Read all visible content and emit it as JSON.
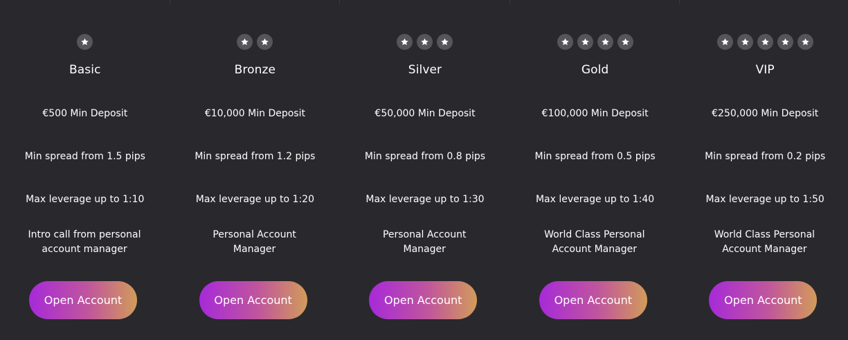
{
  "colors": {
    "background": "#29282d",
    "star_badge": "#56555b",
    "text": "#ffffff",
    "button_gradient_start": "#a62ad9",
    "button_gradient_end": "#d29b5a"
  },
  "plans": [
    {
      "name": "Basic",
      "stars": 1,
      "features": [
        "€500 Min Deposit",
        "Min spread from 1.5 pips",
        "Max leverage up to 1:10",
        "Intro call from personal account manager"
      ],
      "button_label": "Open Account"
    },
    {
      "name": "Bronze",
      "stars": 2,
      "features": [
        "€10,000 Min Deposit",
        "Min spread from 1.2 pips",
        "Max leverage up to 1:20",
        "Personal Account Manager"
      ],
      "button_label": "Open Account"
    },
    {
      "name": "Silver",
      "stars": 3,
      "features": [
        "€50,000 Min Deposit",
        "Min spread from 0.8 pips",
        "Max leverage up to 1:30",
        "Personal Account Manager"
      ],
      "button_label": "Open Account"
    },
    {
      "name": "Gold",
      "stars": 4,
      "features": [
        "€100,000 Min Deposit",
        "Min spread from 0.5 pips",
        "Max leverage up to 1:40",
        "World Class Personal Account Manager"
      ],
      "button_label": "Open Account"
    },
    {
      "name": "VIP",
      "stars": 5,
      "features": [
        "€250,000 Min Deposit",
        "Min spread from 0.2 pips",
        "Max leverage up to 1:50",
        "World Class Personal Account Manager"
      ],
      "button_label": "Open Account"
    }
  ]
}
